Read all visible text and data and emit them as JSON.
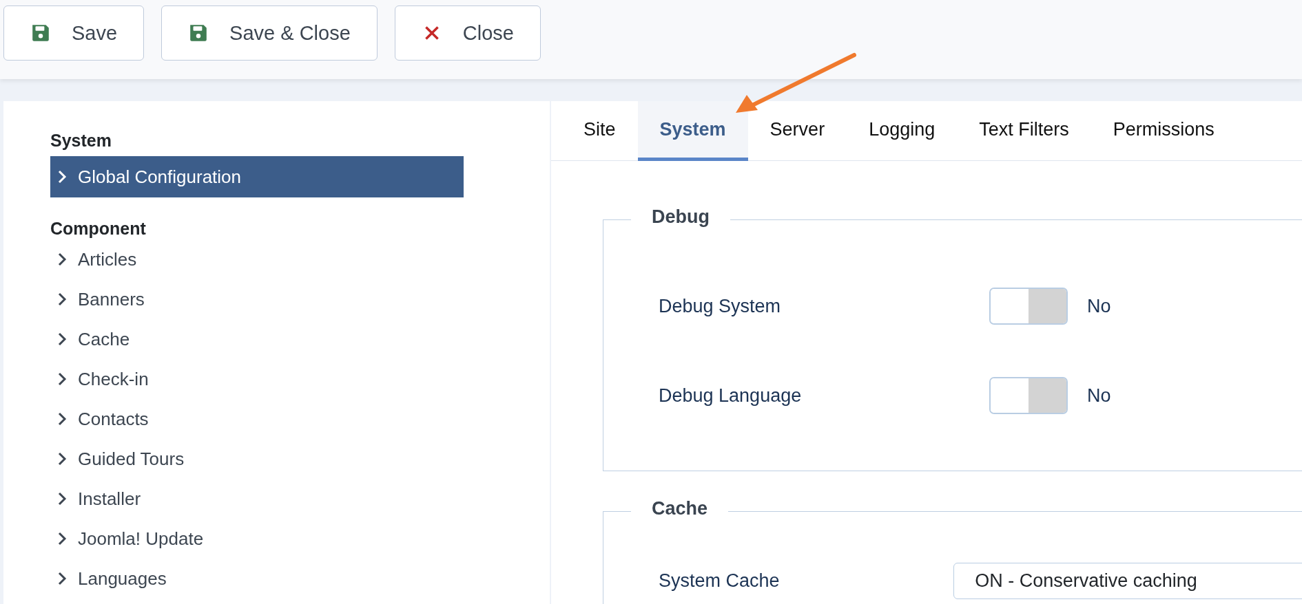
{
  "toolbar": {
    "buttons": [
      {
        "label": "Save",
        "kind": "save"
      },
      {
        "label": "Save & Close",
        "kind": "save"
      },
      {
        "label": "Close",
        "kind": "close"
      }
    ]
  },
  "sidebar": {
    "groups": [
      {
        "heading": "System",
        "items": [
          {
            "label": "Global Configuration",
            "selected": true
          }
        ]
      },
      {
        "heading": "Component",
        "items": [
          {
            "label": "Articles",
            "selected": false
          },
          {
            "label": "Banners",
            "selected": false
          },
          {
            "label": "Cache",
            "selected": false
          },
          {
            "label": "Check-in",
            "selected": false
          },
          {
            "label": "Contacts",
            "selected": false
          },
          {
            "label": "Guided Tours",
            "selected": false
          },
          {
            "label": "Installer",
            "selected": false
          },
          {
            "label": "Joomla! Update",
            "selected": false
          },
          {
            "label": "Languages",
            "selected": false
          }
        ]
      }
    ]
  },
  "tabs": [
    {
      "label": "Site",
      "selected": false
    },
    {
      "label": "System",
      "selected": true
    },
    {
      "label": "Server",
      "selected": false
    },
    {
      "label": "Logging",
      "selected": false
    },
    {
      "label": "Text Filters",
      "selected": false
    },
    {
      "label": "Permissions",
      "selected": false
    }
  ],
  "fieldsets": [
    {
      "legend": "Debug",
      "fields": [
        {
          "label": "Debug System",
          "kind": "toggle",
          "on": false,
          "value": "No"
        },
        {
          "label": "Debug Language",
          "kind": "toggle",
          "on": false,
          "value": "No"
        }
      ]
    },
    {
      "legend": "Cache",
      "fields": [
        {
          "label": "System Cache",
          "kind": "select",
          "value": "ON - Conservative caching"
        }
      ]
    }
  ]
}
